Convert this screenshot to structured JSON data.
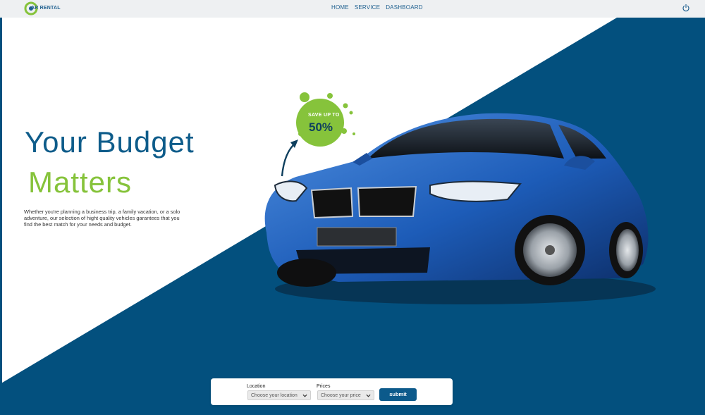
{
  "navbar": {
    "logo_text": "AR RENTAL",
    "links": [
      "HOME",
      "SERVICE",
      "DASHBOARD"
    ],
    "power_icon": "power-icon"
  },
  "hero": {
    "headline_line1": "Your Budget",
    "headline_line2": "Matters",
    "description": "Whether you're planning a business trip, a family vacation, or a solo adventure, our selection of hight quality vehicles garantees that you find the best match for your needs and budget.",
    "badge_line1": "SAVE UP TO",
    "badge_line2": "50%",
    "car_image": "blue-sports-car"
  },
  "search": {
    "location_label": "Location",
    "location_placeholder": "Choose your location",
    "prices_label": "Prices",
    "prices_placeholder": "Choose your price",
    "submit_label": "submit"
  },
  "colors": {
    "primary_blue": "#03507e",
    "accent_green": "#86c33b",
    "headline_blue": "#0e5c8a",
    "nav_bg": "#eef0f2"
  }
}
